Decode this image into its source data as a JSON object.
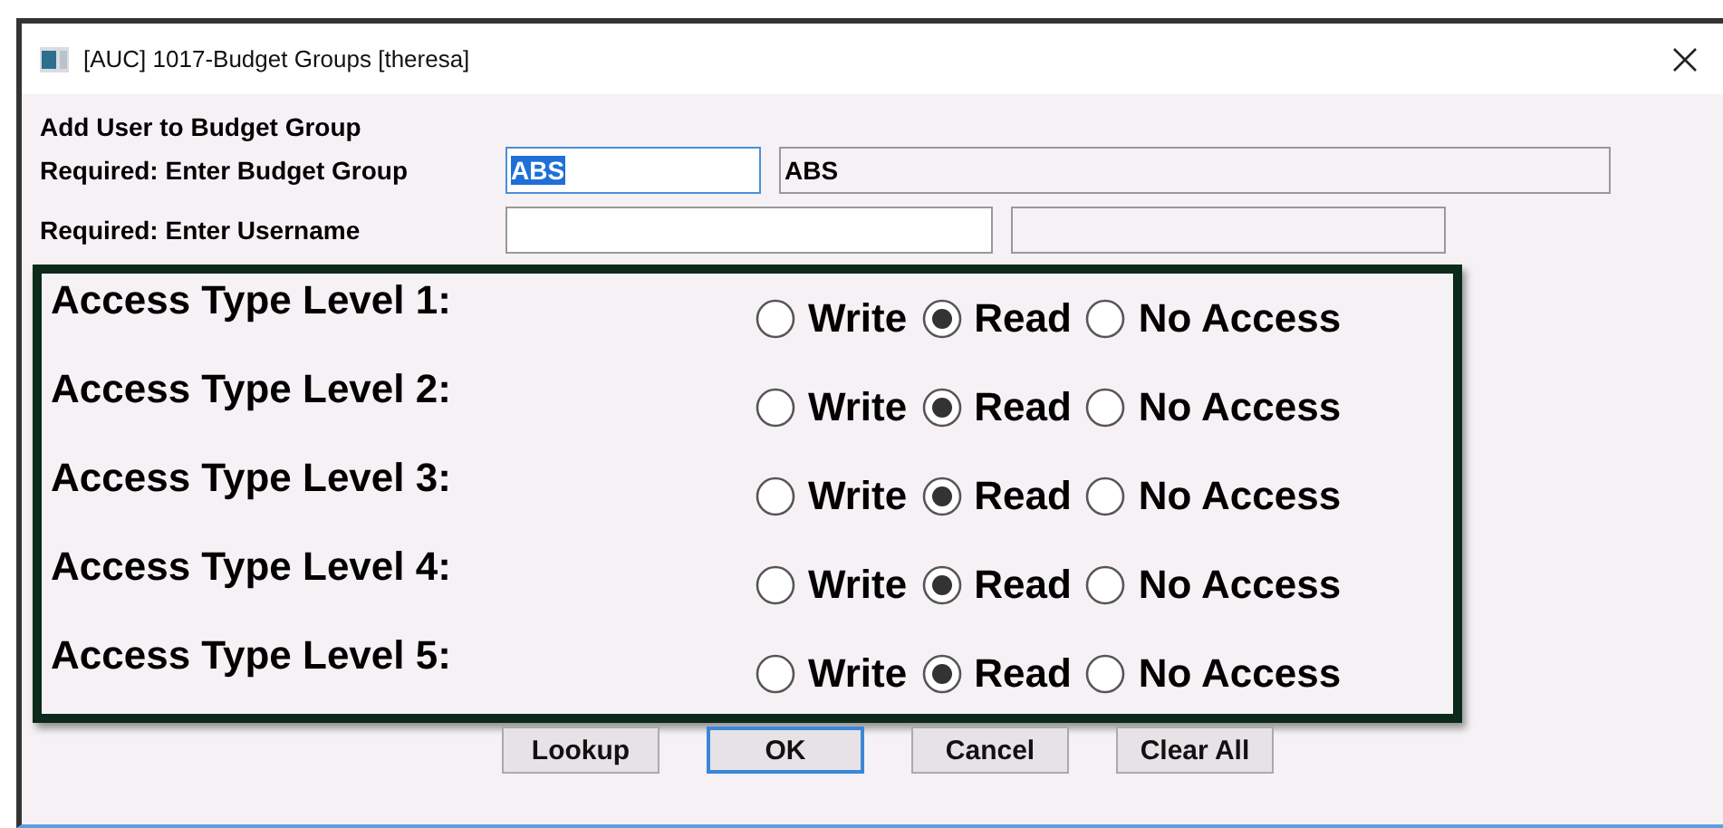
{
  "window": {
    "title": "[AUC] 1017-Budget Groups [theresa]"
  },
  "heading": "Add User to Budget Group",
  "fields": [
    {
      "label": "Required: Enter Budget Group",
      "value": "ABS",
      "value_selected": true,
      "focused": true,
      "description": "ABS"
    },
    {
      "label": "Required: Enter Username",
      "focused": false
    }
  ],
  "access_levels": [
    {
      "label": "Access Type Level 1:",
      "options": [
        {
          "label": "Write",
          "selected": false
        },
        {
          "label": "Read",
          "selected": true
        },
        {
          "label": "No Access",
          "selected": false
        }
      ]
    },
    {
      "label": "Access Type Level 2:",
      "options": [
        {
          "label": "Write",
          "selected": false
        },
        {
          "label": "Read",
          "selected": true
        },
        {
          "label": "No Access",
          "selected": false
        }
      ]
    },
    {
      "label": "Access Type Level 3:",
      "options": [
        {
          "label": "Write",
          "selected": false
        },
        {
          "label": "Read",
          "selected": true
        },
        {
          "label": "No Access",
          "selected": false
        }
      ]
    },
    {
      "label": "Access Type Level 4:",
      "options": [
        {
          "label": "Write",
          "selected": false
        },
        {
          "label": "Read",
          "selected": true
        },
        {
          "label": "No Access",
          "selected": false
        }
      ]
    },
    {
      "label": "Access Type Level 5:",
      "options": [
        {
          "label": "Write",
          "selected": false
        },
        {
          "label": "Read",
          "selected": true
        },
        {
          "label": "No Access",
          "selected": false
        }
      ]
    }
  ],
  "buttons": [
    {
      "label": "Lookup",
      "focused": false
    },
    {
      "label": "OK",
      "focused": true
    },
    {
      "label": "Cancel",
      "focused": false
    },
    {
      "label": "Clear All",
      "focused": false
    }
  ]
}
